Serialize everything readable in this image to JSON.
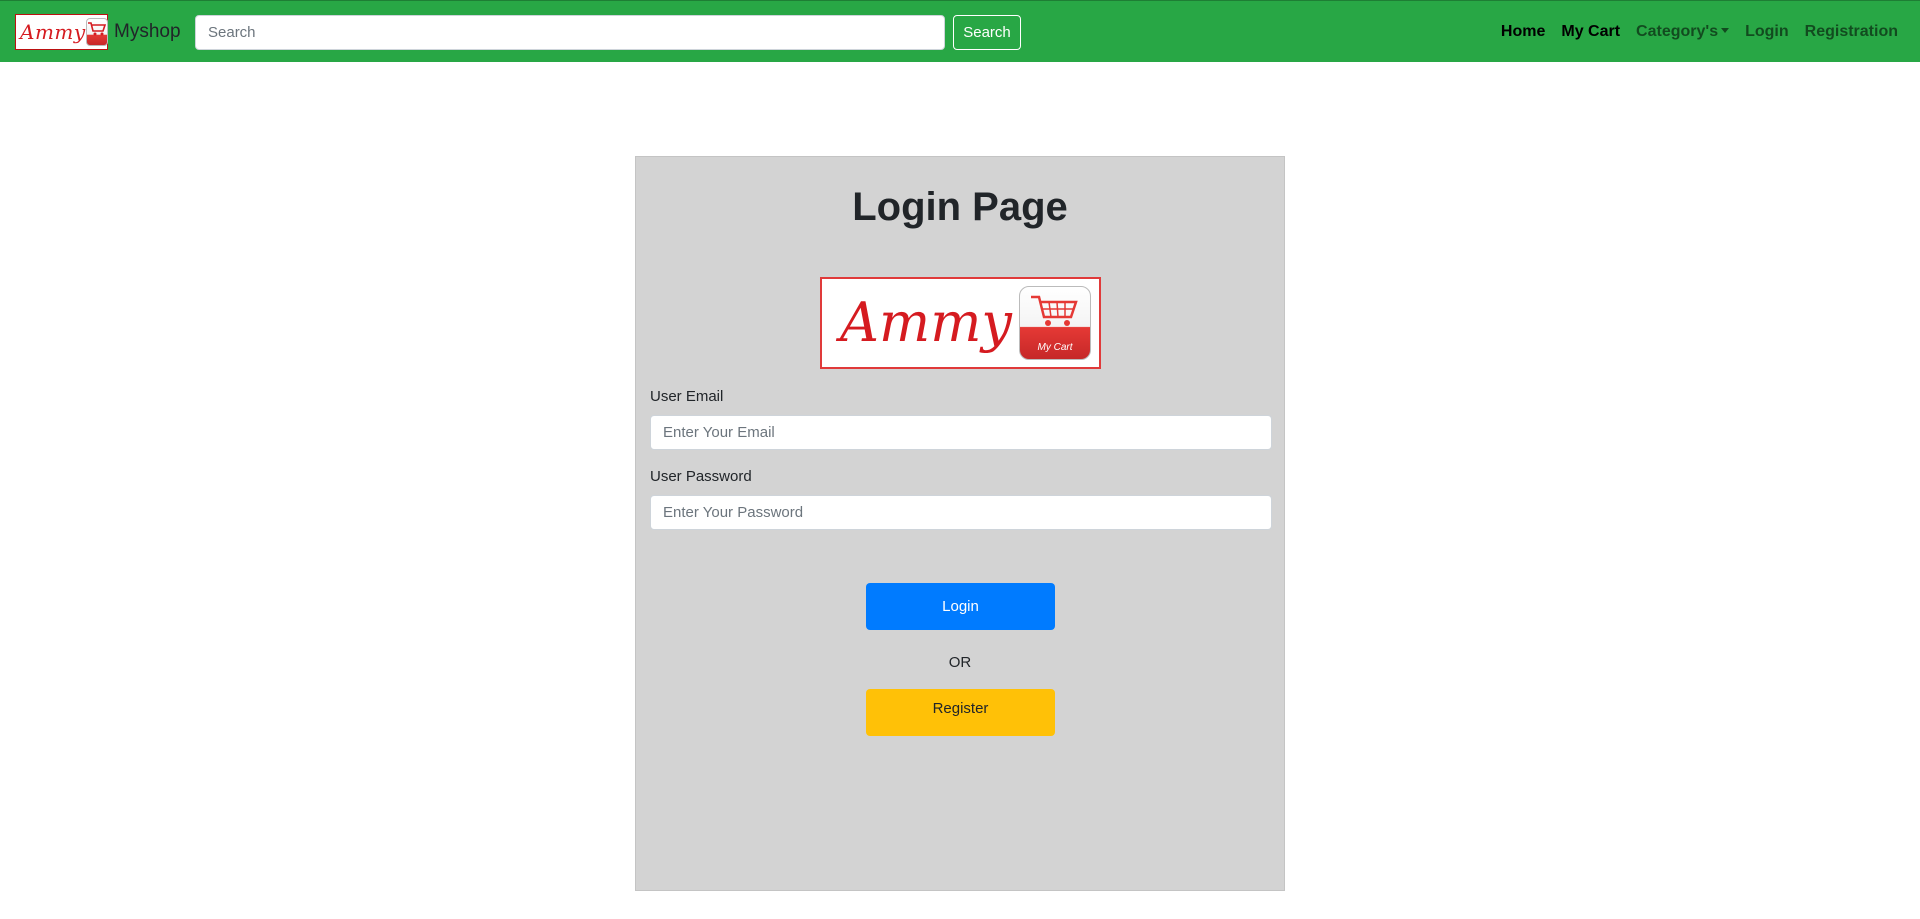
{
  "colors": {
    "brand_green": "#28a745",
    "primary_blue": "#007bff",
    "warning_yellow": "#ffc107",
    "card_gray": "#d3d3d3",
    "logo_red": "#d51b20"
  },
  "navbar": {
    "logo_script": "Ammy",
    "logo_icon": "shopping-cart-icon",
    "brand_text": "Myshop",
    "search": {
      "placeholder": "Search",
      "value": "",
      "button_label": "Search"
    },
    "links": {
      "home": "Home",
      "cart": "My Cart",
      "categories": "Category's",
      "login": "Login",
      "registration": "Registration"
    }
  },
  "login_card": {
    "title": "Login Page",
    "logo": {
      "script": "Ammy",
      "cart_label": "My Cart",
      "icon": "shopping-cart-icon"
    },
    "email": {
      "label": "User Email",
      "placeholder": "Enter Your Email",
      "value": ""
    },
    "password": {
      "label": "User Password",
      "placeholder": "Enter Your Password",
      "value": ""
    },
    "login_button": "Login",
    "separator": "OR",
    "register_button": "Register"
  }
}
